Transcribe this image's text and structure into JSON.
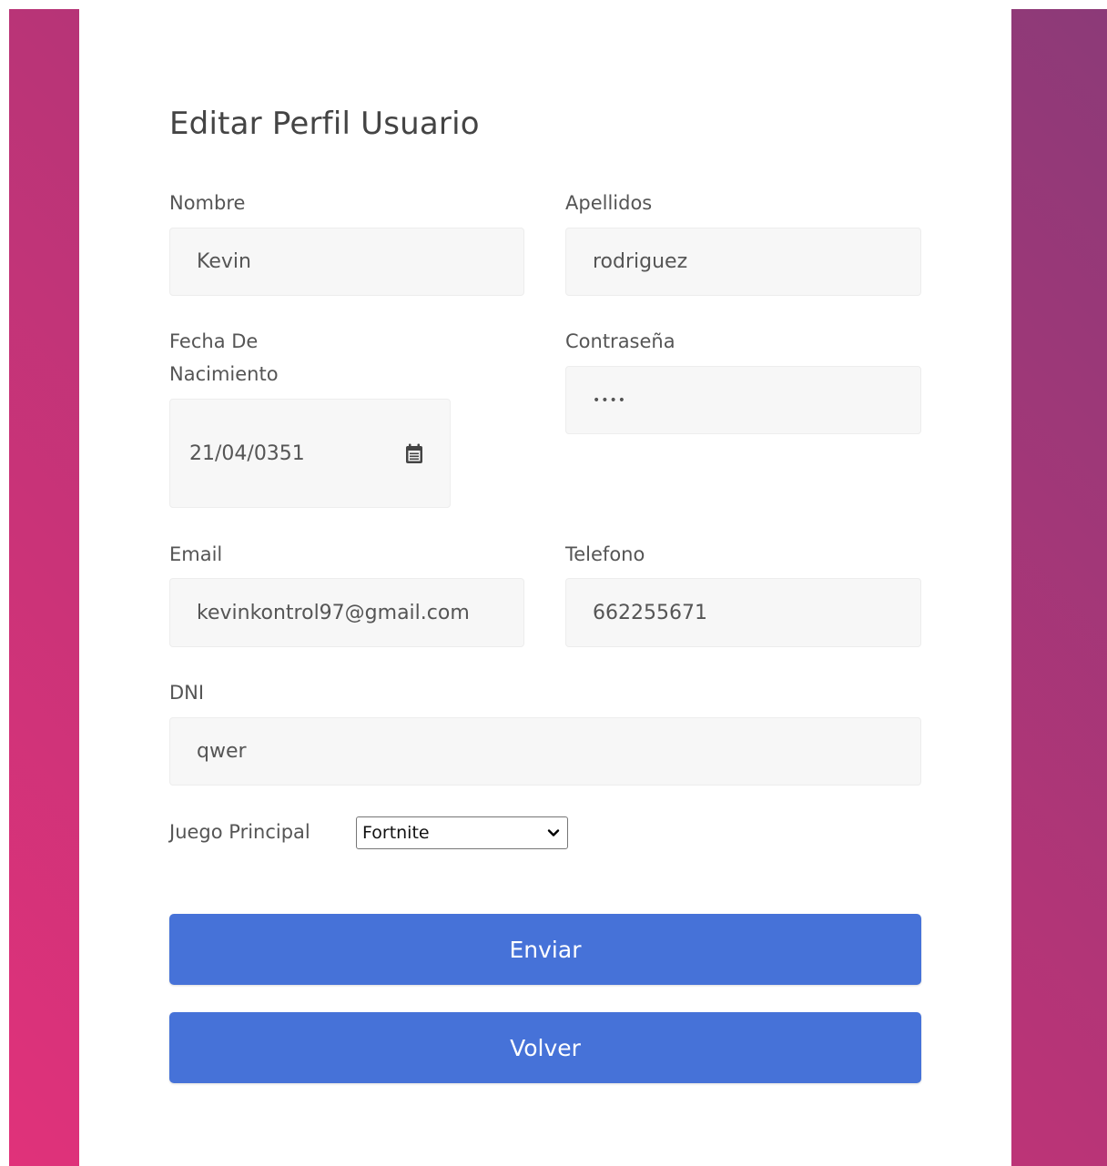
{
  "form": {
    "title": "Editar Perfil Usuario",
    "fields": {
      "nombre": {
        "label": "Nombre",
        "value": "Kevin"
      },
      "apellidos": {
        "label": "Apellidos",
        "value": "rodriguez"
      },
      "fecha": {
        "label_line1": "Fecha De",
        "label_line2": "Nacimiento",
        "value": "21/04/0351"
      },
      "contrasena": {
        "label": "Contraseña",
        "value": "••••"
      },
      "email": {
        "label": "Email",
        "value": "kevinkontrol97@gmail.com"
      },
      "telefono": {
        "label": "Telefono",
        "value": "662255671"
      },
      "dni": {
        "label": "DNI",
        "value": "qwer"
      },
      "juego": {
        "label": "Juego Principal",
        "selected": "Fortnite"
      }
    },
    "buttons": {
      "submit": "Enviar",
      "back": "Volver"
    }
  },
  "colors": {
    "button": "#4672d8",
    "gradient_start": "#e0327a",
    "gradient_end": "#8c3a78"
  },
  "icons": {
    "calendar": "calendar-icon",
    "dropdown": "chevron-down-icon"
  }
}
